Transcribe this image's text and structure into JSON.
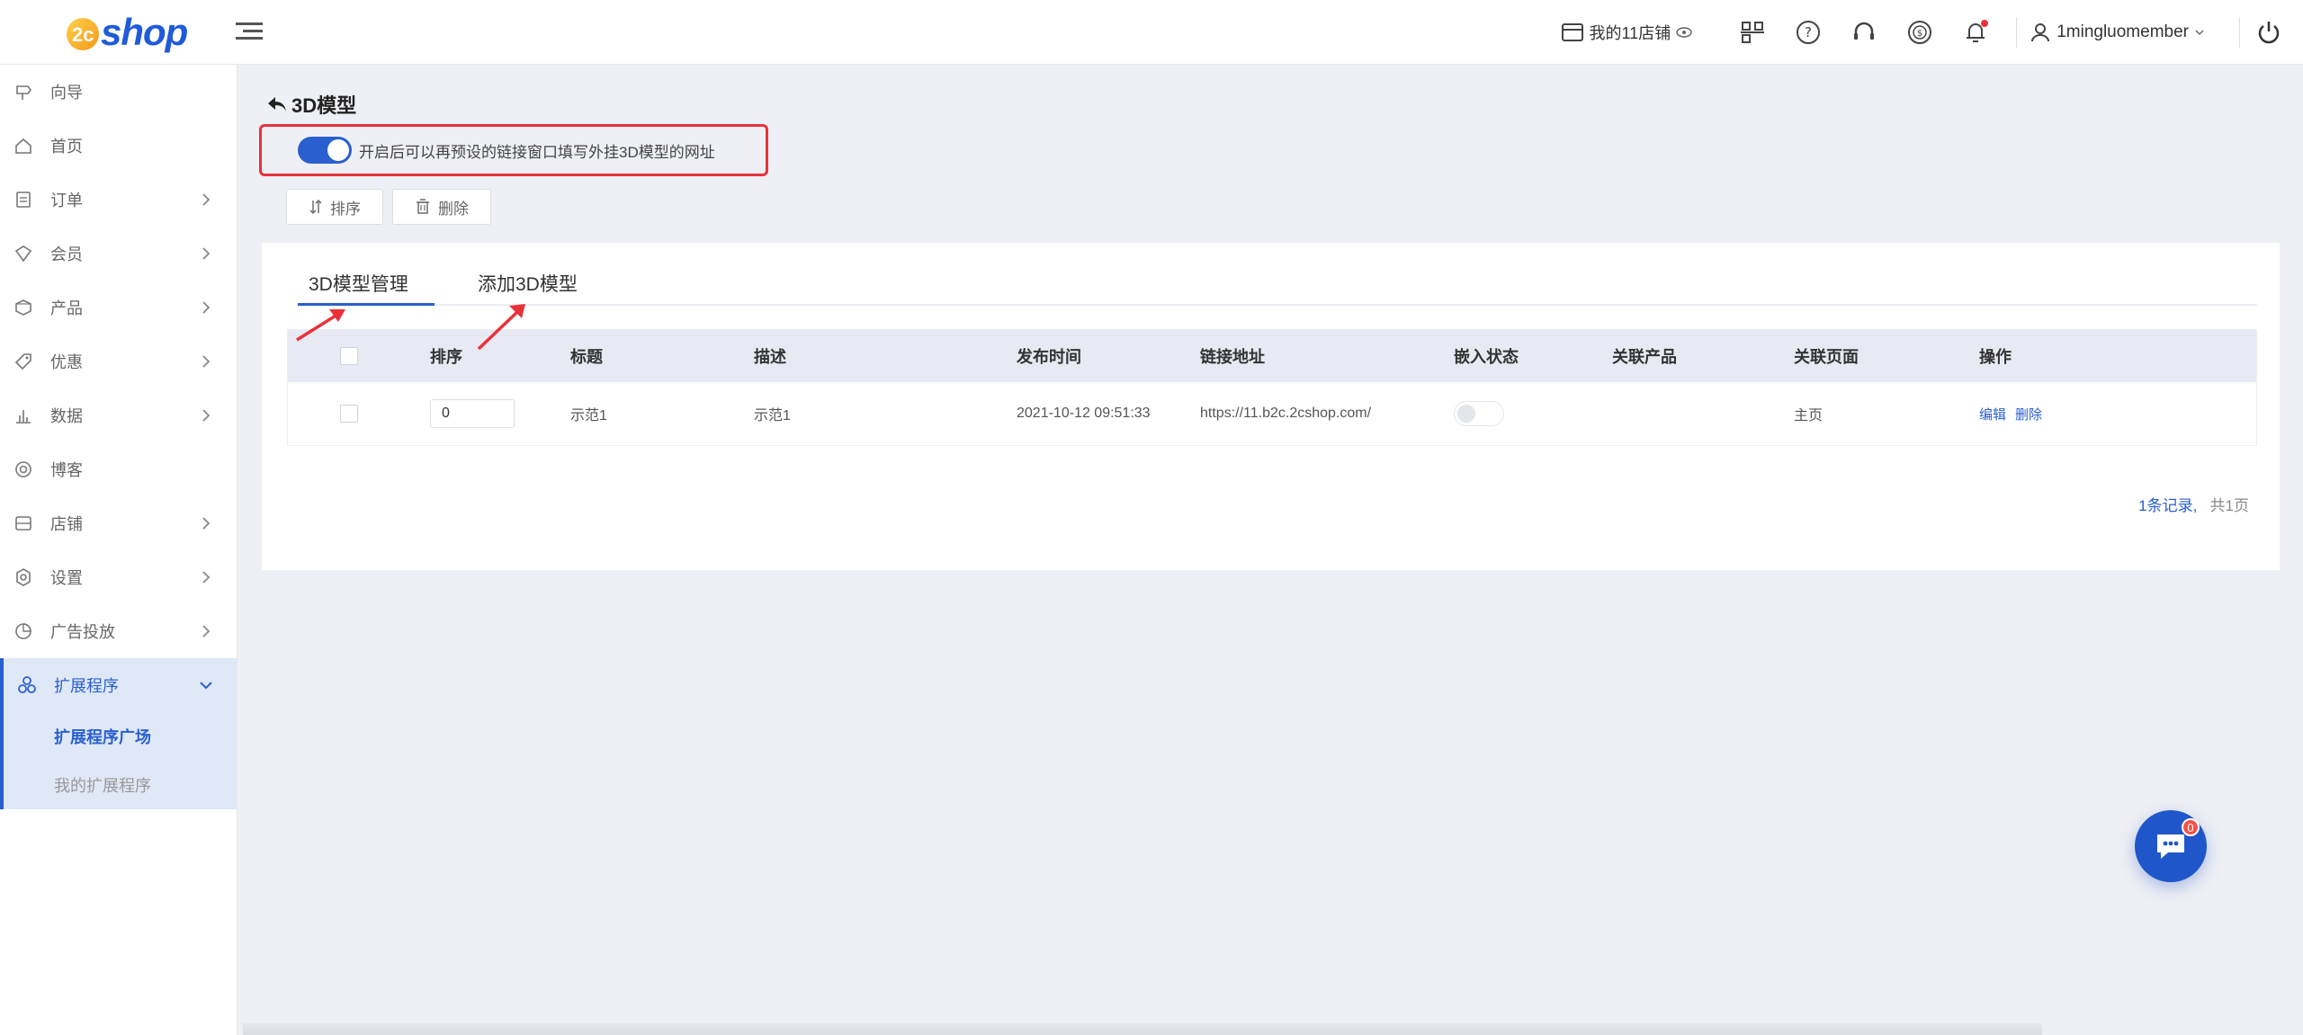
{
  "logo": {
    "mark": "2c",
    "text": "shop"
  },
  "header": {
    "store_label": "我的11店铺",
    "username": "1mingluomember"
  },
  "sidebar": {
    "items": [
      {
        "label": "向导",
        "icon": "signpost-icon",
        "has_children": false
      },
      {
        "label": "首页",
        "icon": "home-icon",
        "has_children": false
      },
      {
        "label": "订单",
        "icon": "order-icon",
        "has_children": true
      },
      {
        "label": "会员",
        "icon": "member-icon",
        "has_children": true
      },
      {
        "label": "产品",
        "icon": "product-icon",
        "has_children": true
      },
      {
        "label": "优惠",
        "icon": "coupon-icon",
        "has_children": true
      },
      {
        "label": "数据",
        "icon": "chart-icon",
        "has_children": true
      },
      {
        "label": "博客",
        "icon": "blog-icon",
        "has_children": false
      },
      {
        "label": "店铺",
        "icon": "store-icon",
        "has_children": true
      },
      {
        "label": "设置",
        "icon": "settings-icon",
        "has_children": true
      },
      {
        "label": "广告投放",
        "icon": "ads-icon",
        "has_children": true
      },
      {
        "label": "扩展程序",
        "icon": "extension-icon",
        "has_children": true,
        "active": true
      }
    ],
    "sub_items": [
      {
        "label": "扩展程序广场",
        "active": true
      },
      {
        "label": "我的扩展程序",
        "active": false
      }
    ]
  },
  "page": {
    "title": "3D模型",
    "toggle_label": "开启后可以再预设的链接窗口填写外挂3D模型的网址",
    "toggle_on": true,
    "buttons": {
      "sort": "排序",
      "delete": "删除"
    },
    "tabs": [
      {
        "label": "3D模型管理",
        "active": true
      },
      {
        "label": "添加3D模型",
        "active": false
      }
    ]
  },
  "table": {
    "headers": {
      "sort": "排序",
      "title": "标题",
      "desc": "描述",
      "published": "发布时间",
      "link": "链接地址",
      "embed": "嵌入状态",
      "product": "关联产品",
      "page": "关联页面",
      "ops": "操作"
    },
    "rows": [
      {
        "sort": "0",
        "title": "示范1",
        "desc": "示范1",
        "published": "2021-10-12 09:51:33",
        "link": "https://11.b2c.2cshop.com/",
        "embed_on": false,
        "product": "",
        "page": "主页",
        "edit": "编辑",
        "delete": "删除"
      }
    ]
  },
  "pagination": {
    "records": "1条记录,",
    "pages": "共1页"
  },
  "chat": {
    "badge": "0"
  },
  "colors": {
    "accent": "#2a5fd0",
    "highlight": "#e8323a",
    "bg": "#eff0f5"
  }
}
